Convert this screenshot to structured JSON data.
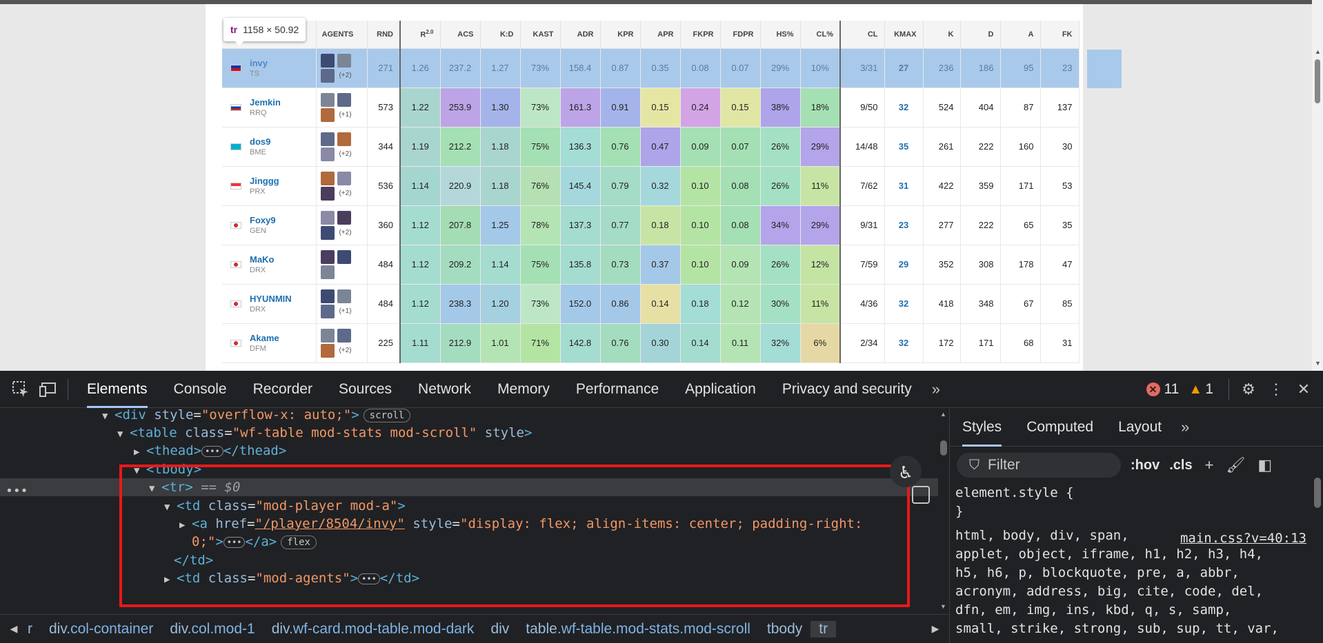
{
  "tooltip": {
    "tag": "tr",
    "size": "1158 × 50.92"
  },
  "table": {
    "headers": [
      "",
      "AGENTS",
      "RND",
      "R2.0",
      "ACS",
      "K:D",
      "KAST",
      "ADR",
      "KPR",
      "APR",
      "FKPR",
      "FDPR",
      "HS%",
      "CL%",
      "CL",
      "KMAX",
      "K",
      "D",
      "A",
      "FK"
    ],
    "rows": [
      {
        "name": "invy",
        "team": "TS",
        "flag": "PH",
        "more": "(+2)",
        "cells": [
          "271",
          "1.26",
          "237.2",
          "1.27",
          "73%",
          "158.4",
          "0.87",
          "0.35",
          "0.08",
          "0.07",
          "29%",
          "10%",
          "3/31",
          "27",
          "236",
          "186",
          "95",
          "23"
        ]
      },
      {
        "name": "Jemkin",
        "team": "RRQ",
        "flag": "RU",
        "more": "(+1)",
        "cells": [
          "573",
          "1.22",
          "253.9",
          "1.30",
          "73%",
          "161.3",
          "0.91",
          "0.15",
          "0.24",
          "0.15",
          "38%",
          "18%",
          "9/50",
          "32",
          "524",
          "404",
          "87",
          "137"
        ]
      },
      {
        "name": "dos9",
        "team": "BME",
        "flag": "KZ",
        "more": "(+2)",
        "cells": [
          "344",
          "1.19",
          "212.2",
          "1.18",
          "75%",
          "136.3",
          "0.76",
          "0.47",
          "0.09",
          "0.07",
          "26%",
          "29%",
          "14/48",
          "35",
          "261",
          "222",
          "160",
          "30"
        ]
      },
      {
        "name": "Jinggg",
        "team": "PRX",
        "flag": "SG",
        "more": "(+2)",
        "cells": [
          "536",
          "1.14",
          "220.9",
          "1.18",
          "76%",
          "145.4",
          "0.79",
          "0.32",
          "0.10",
          "0.08",
          "26%",
          "11%",
          "7/62",
          "31",
          "422",
          "359",
          "171",
          "53"
        ]
      },
      {
        "name": "Foxy9",
        "team": "GEN",
        "flag": "KR",
        "more": "(+2)",
        "cells": [
          "360",
          "1.12",
          "207.8",
          "1.25",
          "78%",
          "137.3",
          "0.77",
          "0.18",
          "0.10",
          "0.08",
          "34%",
          "29%",
          "9/31",
          "23",
          "277",
          "222",
          "65",
          "35"
        ]
      },
      {
        "name": "MaKo",
        "team": "DRX",
        "flag": "KR",
        "more": "",
        "cells": [
          "484",
          "1.12",
          "209.2",
          "1.14",
          "75%",
          "135.8",
          "0.73",
          "0.37",
          "0.10",
          "0.09",
          "26%",
          "12%",
          "7/59",
          "29",
          "352",
          "308",
          "178",
          "47"
        ]
      },
      {
        "name": "HYUNMIN",
        "team": "DRX",
        "flag": "KR",
        "more": "(+1)",
        "cells": [
          "484",
          "1.12",
          "238.3",
          "1.20",
          "73%",
          "152.0",
          "0.86",
          "0.14",
          "0.18",
          "0.12",
          "30%",
          "11%",
          "4/36",
          "32",
          "418",
          "348",
          "67",
          "85"
        ]
      },
      {
        "name": "Akame",
        "team": "DFM",
        "flag": "KR",
        "more": "(+2)",
        "cells": [
          "225",
          "1.11",
          "212.9",
          "1.01",
          "71%",
          "142.8",
          "0.76",
          "0.30",
          "0.14",
          "0.11",
          "32%",
          "6%",
          "2/34",
          "32",
          "172",
          "171",
          "68",
          "31"
        ]
      }
    ]
  },
  "cell_colors": [
    [
      "#9fd9da",
      "#b3d9e6",
      "#9fd9da",
      "#bde6c6",
      "#c9dcef",
      "#a9d3df",
      "#9fd9da",
      "#b3e0c8",
      "#9fd9da",
      "#a8d6ce",
      "#b4b9ec"
    ],
    [
      "#a8d6ce",
      "#bca4e6",
      "#a4b4ea",
      "#bde6c6",
      "#bca4e6",
      "#a4b4ea",
      "#e6e6a4",
      "#d2a4e6",
      "#e0e6a4",
      "#ada4ea",
      "#a4e0b4"
    ],
    [
      "#a8d6ce",
      "#a4e0b4",
      "#a8d6ce",
      "#a4e0b4",
      "#a4dcd6",
      "#a4e0b4",
      "#ada4ea",
      "#a4e0b4",
      "#a4e0b4",
      "#a4e0c4",
      "#b4a4ea"
    ],
    [
      "#a4d6d0",
      "#b4d8da",
      "#a8d6ce",
      "#b4e0b4",
      "#a4d8dc",
      "#a4dcc8",
      "#a4d8dc",
      "#b4e4a4",
      "#a4e0b4",
      "#a4e0c4",
      "#c8e4a4"
    ],
    [
      "#a4dcd0",
      "#a4dcb4",
      "#a4c8e8",
      "#b4e4b4",
      "#a4dcd0",
      "#a4dcc8",
      "#c8e4a4",
      "#b4e4a4",
      "#a4e0b4",
      "#b4a4ea",
      "#b4a4ea"
    ],
    [
      "#a4dcd0",
      "#a4dcc0",
      "#a4dcd0",
      "#a4e0b4",
      "#a4dcd0",
      "#a4dcc0",
      "#a4c8e8",
      "#b4e4a4",
      "#b4e4b4",
      "#a4e0c4",
      "#c4e4a4"
    ],
    [
      "#a4dcd0",
      "#a4c8e8",
      "#a4d0e0",
      "#bde6c6",
      "#a4c8e8",
      "#a4c8e8",
      "#e6e0a4",
      "#a4dcd6",
      "#b4e4b4",
      "#a4e0c4",
      "#c8e4a4"
    ],
    [
      "#a4dcd0",
      "#a4dcc0",
      "#b4e4b4",
      "#b4e4a4",
      "#a4dcd0",
      "#a4dcc0",
      "#a4d4d8",
      "#a4dcd0",
      "#b4e4b4",
      "#a4dcd6",
      "#e6d8a4"
    ]
  ],
  "devtools": {
    "tabs": [
      "Elements",
      "Console",
      "Recorder",
      "Sources",
      "Network",
      "Memory",
      "Performance",
      "Application",
      "Privacy and security"
    ],
    "active_tab": "Elements",
    "error_count": "11",
    "warning_count": "1",
    "dom": {
      "l0": {
        "pre": "<div ",
        "attr": "style",
        "val": "\"overflow-x: auto;\"",
        "post": ">",
        "pill": "scroll"
      },
      "l1": {
        "pre": "<table ",
        "attr": "class",
        "val": "\"wf-table mod-stats mod-scroll\"",
        "attr2": "style",
        "post": ">"
      },
      "l2": {
        "pre": "<thead>",
        "post": "</thead>"
      },
      "l3": {
        "pre": "<tbody>"
      },
      "l4": {
        "pre": "<tr>",
        "post": " == $0"
      },
      "l5": {
        "pre": "<td ",
        "attr": "class",
        "val": "\"mod-player mod-a\"",
        "post": ">"
      },
      "l6": {
        "pre": "<a ",
        "attr": "href",
        "val": "\"/player/8504/invy\"",
        "attr2": "style",
        "val2": "\"display: flex; align-items: center; padding-right:",
        "post": ""
      },
      "l7": {
        "val": "0;\"",
        "post": ">",
        "post2": "</a>",
        "pill": "flex"
      },
      "l8": {
        "pre": "</td>"
      },
      "l9": {
        "pre": "<td ",
        "attr": "class",
        "val": "\"mod-agents\"",
        "post": ">",
        "post2": "</td>"
      }
    },
    "breadcrumbs": [
      {
        "tag": "r",
        "cls": ""
      },
      {
        "tag": "div",
        "cls": ".col-container"
      },
      {
        "tag": "div",
        "cls": ".col.mod-1"
      },
      {
        "tag": "div",
        "cls": ".wf-card.mod-table.mod-dark"
      },
      {
        "tag": "div",
        "cls": ""
      },
      {
        "tag": "table",
        "cls": ".wf-table.mod-stats.mod-scroll"
      },
      {
        "tag": "tbody",
        "cls": ""
      },
      {
        "tag": "tr",
        "cls": ""
      }
    ],
    "styles": {
      "tabs": [
        "Styles",
        "Computed",
        "Layout"
      ],
      "filter_placeholder": "Filter",
      "hov": ":hov",
      "cls": ".cls",
      "element_style": "element.style {",
      "close_brace": "}",
      "source": "main.css?v=40:13",
      "selector_lines": [
        "html, body, div, span,",
        "applet, object, iframe, h1, h2, h3, h4,",
        "h5, h6, p, blockquote, pre, a, abbr,",
        "acronym, address, big, cite, code, del,",
        "dfn, em, img, ins, kbd, q, s, samp,",
        "small, strike, strong, sub, sup, tt, var,"
      ]
    }
  }
}
